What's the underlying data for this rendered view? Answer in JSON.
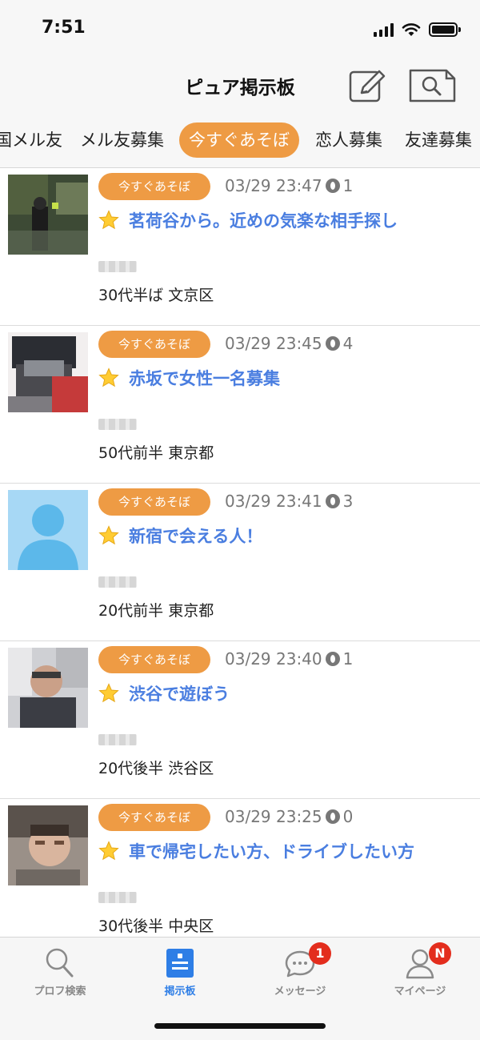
{
  "status_bar": {
    "time": "7:51"
  },
  "header": {
    "title": "ピュア掲示板"
  },
  "tabs": [
    {
      "label": "国メル友"
    },
    {
      "label": "メル友募集"
    },
    {
      "label": "今すぐあそぼ",
      "active": true
    },
    {
      "label": "恋人募集"
    },
    {
      "label": "友達募集"
    }
  ],
  "posts": [
    {
      "category": "今すぐあそぼ",
      "datetime": "03/29 23:47",
      "views": "1",
      "title": "茗荷谷から。近めの気楽な相手探し",
      "info": "30代半ば  文京区"
    },
    {
      "category": "今すぐあそぼ",
      "datetime": "03/29 23:45",
      "views": "4",
      "title": "赤坂で女性一名募集",
      "info": "50代前半  東京都"
    },
    {
      "category": "今すぐあそぼ",
      "datetime": "03/29 23:41",
      "views": "3",
      "title": "新宿で会える人！",
      "info": "20代前半  東京都"
    },
    {
      "category": "今すぐあそぼ",
      "datetime": "03/29 23:40",
      "views": "1",
      "title": "渋谷で遊ぼう",
      "info": "20代後半  渋谷区"
    },
    {
      "category": "今すぐあそぼ",
      "datetime": "03/29 23:25",
      "views": "0",
      "title": "車で帰宅したい方、ドライブしたい方",
      "info": "30代後半  中央区"
    }
  ],
  "tabbar": {
    "items": [
      {
        "label": "プロフ検索",
        "icon": "search-icon"
      },
      {
        "label": "掲示板",
        "icon": "board-icon",
        "active": true
      },
      {
        "label": "メッセージ",
        "icon": "message-icon",
        "badge": "1"
      },
      {
        "label": "マイページ",
        "icon": "person-icon",
        "badge": "N"
      }
    ]
  },
  "colors": {
    "accent": "#ee9b44",
    "link": "#4a7ee0",
    "active_tab": "#2e7ee6",
    "badge": "#e32d1d"
  }
}
